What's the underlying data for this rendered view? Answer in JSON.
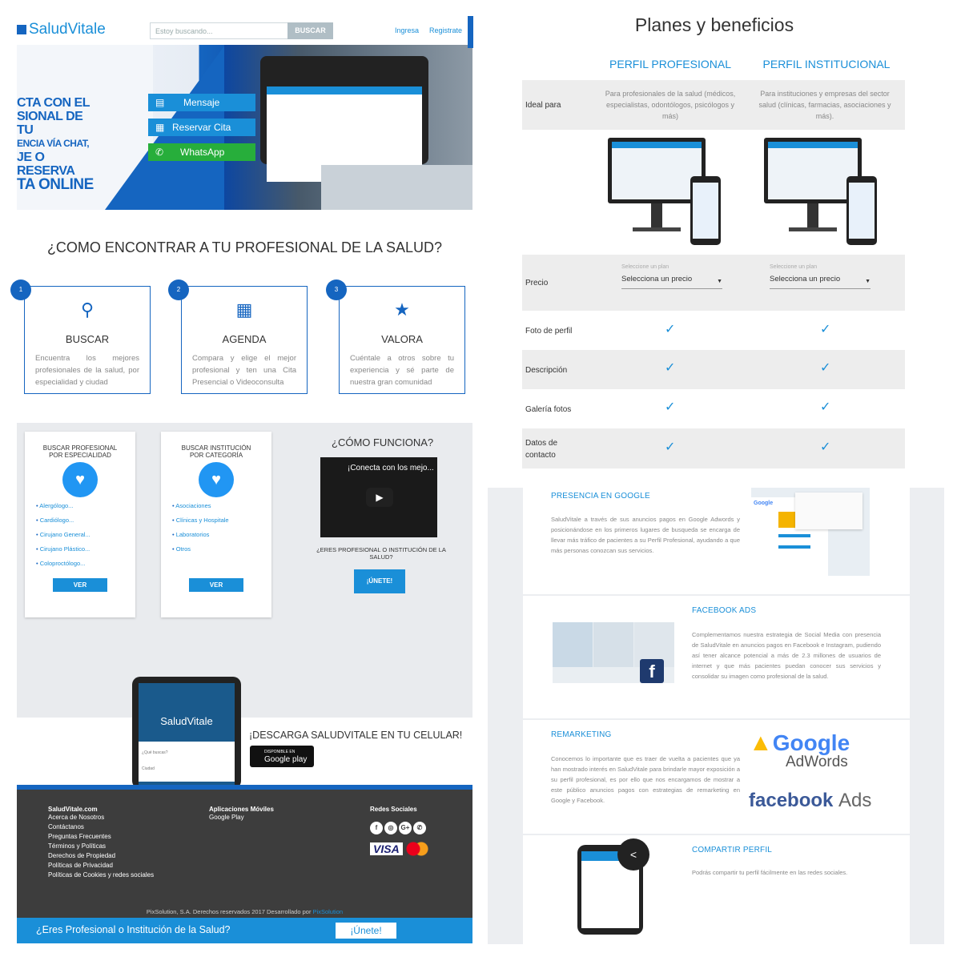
{
  "header": {
    "logo": "SaludVitale",
    "search_placeholder": "Estoy buscando...",
    "search_button": "BUSCAR",
    "login": "Ingresa",
    "register": "Registrate"
  },
  "hero": {
    "text_lines": [
      "CTA CON EL",
      "SIONAL DE TU",
      "ENCIA VÍA CHAT,",
      "JE O RESERVA",
      "TA ONLINE"
    ],
    "buttons": [
      "Mensaje",
      "Reservar Cita",
      "WhatsApp"
    ],
    "button_colors": [
      "#1a8fd8",
      "#1a8fd8",
      "#27ae3b"
    ]
  },
  "how": {
    "title": "¿COMO ENCONTRAR A TU PROFESIONAL DE LA SALUD?",
    "steps": [
      {
        "num": "1",
        "icon": "search-icon",
        "title": "BUSCAR",
        "desc": "Encuentra los mejores profesionales de la salud, por especialidad y ciudad"
      },
      {
        "num": "2",
        "icon": "calendar-icon",
        "title": "AGENDA",
        "desc": "Compara y elige el mejor profesional y ten una Cita Presencial o Videoconsulta"
      },
      {
        "num": "3",
        "icon": "star-icon",
        "title": "VALORA",
        "desc": "Cuéntale a otros sobre tu experiencia y sé parte de nuestra gran comunidad"
      }
    ]
  },
  "browse": {
    "professional": {
      "title_1": "BUSCAR PROFESIONAL",
      "title_2": "POR ESPECIALIDAD",
      "items": [
        "Alergólogo...",
        "Cardiólogo...",
        "Cirujano General...",
        "Cirujano Plástico...",
        "Coloproctólogo..."
      ],
      "button": "VER"
    },
    "institution": {
      "title_1": "BUSCAR INSTITUCIÓN",
      "title_2": "POR CATEGORÍA",
      "items": [
        "Asociaciones",
        "Clínicas y Hospitale",
        "Laboratorios",
        "Otros"
      ],
      "button": "VER"
    },
    "how_works": {
      "title": "¿CÓMO FUNCIONA?",
      "video_title": "¡Conecta con los mejo...",
      "question_1": "¿ERES PROFESIONAL O INSTITUCIÓN DE LA",
      "question_2": "SALUD?",
      "join": "¡ÚNETE!"
    }
  },
  "download": {
    "text": "¡DESCARGA SALUDVITALE EN TU CELULAR!",
    "badge_small": "DISPONIBLE EN",
    "badge": "Google play",
    "phone_logo": "SaludVitale",
    "phone_field_1": "¿Qué buscas?",
    "phone_field_2": "Ciudad"
  },
  "footer": {
    "col1_title": "SaludVitale.com",
    "col1_links": [
      "Acerca de Nosotros",
      "Contáctanos",
      "Preguntas Frecuentes",
      "Términos y Políticas",
      "Derechos de Propiedad",
      "Políticas de Privacidad",
      "Políticas de Cookies y redes sociales"
    ],
    "col2_title": "Aplicaciones Móviles",
    "col2_links": [
      "Google Play"
    ],
    "col3_title": "Redes Sociales",
    "social": [
      "f",
      "◎",
      "G+",
      "✆"
    ],
    "visa": "VISA",
    "copyright": "PixSolution, S.A. Derechos reservados 2017 Desarrollado por",
    "dev": "PixSolution"
  },
  "cta": {
    "question": "¿Eres Profesional o Institución de la Salud?",
    "button": "¡Únete!"
  },
  "plans": {
    "title": "Planes y beneficios",
    "col1": "PERFIL PROFESIONAL",
    "col2": "PERFIL INSTITUCIONAL",
    "ideal_label": "Ideal para",
    "ideal_1": "Para profesionales de la salud (médicos, especialistas, odontólogos, psicólogos y más)",
    "ideal_2": "Para instituciones y empresas del sector salud (clínicas, farmacias, asociaciones y más).",
    "price_label": "Precio",
    "select_label": "Seleccione un plan",
    "select_value": "Selecciona un precio",
    "features": [
      "Foto de perfil",
      "Descripción",
      "Galería fotos",
      "Datos de contacto"
    ],
    "check": "✓"
  },
  "benefits": [
    {
      "title": "PRESENCIA EN GOOGLE",
      "desc": "SaludVitale a través de sus anuncios pagos en Google Adwords y posicionándose en los primeros lugares de busqueda se encarga de llevar más tráfico de pacientes a su Perfil Profesional, ayudando a que más personas conozcan sus servicios."
    },
    {
      "title": "FACEBOOK ADS",
      "desc": "Complementamos nuestra estrategia de Social Media con presencia de SaludVitale en anuncios pagos en Facebook e Instagram, pudiendo así tener alcance potencial a más de 2.3 millones de usuarios de internet y que más pacientes puedan conocer sus servicios y consolidar su imagen como profesional de la salud."
    },
    {
      "title": "REMARKETING",
      "desc": "Conocemos lo importante que es traer de vuelta a pacientes que ya han mostrado interés en SaludVitale para brindarle mayor exposición a su perfil profesional, es por ello que nos encargamos de mostrar a este público anuncios pagos con estrategias de remarketing en Google y Facebook."
    },
    {
      "title": "COMPARTIR PERFIL",
      "desc": "Podrás compartir tu perfil fácilmente en las redes sociales."
    }
  ],
  "logos": {
    "google": "Google",
    "adwords": "AdWords",
    "facebook": "facebook",
    "ads": "Ads"
  }
}
